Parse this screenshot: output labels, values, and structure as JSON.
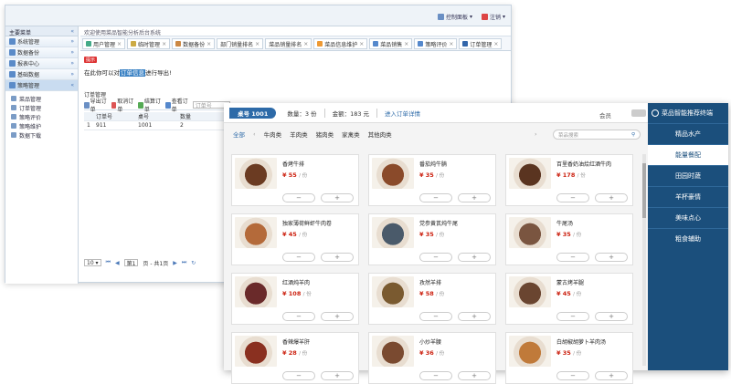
{
  "admin": {
    "control_panel": "控制面板",
    "logout": "注销",
    "nav_header": "主要菜单",
    "nav_items": [
      "系统管理",
      "数据备份",
      "报表中心",
      "基础数据",
      "策略管理"
    ],
    "sub_items": [
      "菜品管理",
      "订单管理",
      "策略评价",
      "策略维护",
      "数据下载"
    ],
    "welcome": "欢迎使用菜品智能分析后台系统",
    "tabs": [
      "用户管理",
      "临时管理",
      "数据备份",
      "部门销量排名",
      "菜品销量排名",
      "菜品信息维护",
      "菜品销售",
      "策略评价",
      "订单管理"
    ],
    "notice_badge": "提示",
    "notice_pre": "在此你可以对",
    "notice_hl": "订单信息",
    "notice_post": "进行导出!",
    "section_title": "订单管理",
    "toolbar": [
      "导出订单",
      "取消订单",
      "结算订单",
      "查看订单"
    ],
    "select_value": "订单号",
    "grid_headers": [
      "",
      "订单号",
      "桌号",
      "数量"
    ],
    "grid_rows": [
      [
        "1",
        "911",
        "1001",
        "2"
      ]
    ],
    "pager_size": "10",
    "pager_page": "第1",
    "pager_info": "页 - 共1页",
    "pager_first": "⏮",
    "pager_prev": "◀",
    "pager_next": "▶",
    "pager_last": "⏭",
    "pager_refresh": "↻"
  },
  "terminal": {
    "table_no": "桌号 1001",
    "quantity": "数量：3 份",
    "total": "金额：183 元",
    "detail_link": "进入订单详情",
    "member": "会员",
    "title": "菜品智能推荐终端",
    "sidebar": [
      "精品水产",
      "能量餐配",
      "田园时蔬",
      "羊杯豪情",
      "美味点心",
      "粗食辅助"
    ],
    "active_sidebar": 1,
    "categories": [
      "全部",
      "牛肉类",
      "羊肉类",
      "猪肉类",
      "家禽类",
      "其他肉类"
    ],
    "search_placeholder": "菜品搜索",
    "unit": "/ 份",
    "dishes": [
      {
        "name": "香烤牛排",
        "price": "¥ 55",
        "color": "#6b3b22"
      },
      {
        "name": "番茄炖牛腩",
        "price": "¥ 35",
        "color": "#8a4a2a"
      },
      {
        "name": "百里香奶油烩红酒牛肉",
        "price": "¥ 178",
        "color": "#5a3420"
      },
      {
        "name": "独家薄荷鲜虾牛肉卷",
        "price": "¥ 45",
        "color": "#b46a3a"
      },
      {
        "name": "党参黄芪炖牛尾",
        "price": "¥ 35",
        "color": "#4a5a6a"
      },
      {
        "name": "牛尾汤",
        "price": "¥ 35",
        "color": "#7a5540"
      },
      {
        "name": "红酒炖羊肉",
        "price": "¥ 108",
        "color": "#6a2a2a"
      },
      {
        "name": "孜然羊排",
        "price": "¥ 58",
        "color": "#7a5a30"
      },
      {
        "name": "蒙古烤羊腿",
        "price": "¥ 45",
        "color": "#6a4530"
      },
      {
        "name": "香辣爆羊肝",
        "price": "¥ 28",
        "color": "#8a3020"
      },
      {
        "name": "小炒羊腰",
        "price": "¥ 36",
        "color": "#7a4a30"
      },
      {
        "name": "白胡椒胡萝卜羊肉汤",
        "price": "¥ 35",
        "color": "#c07a3a"
      }
    ]
  }
}
